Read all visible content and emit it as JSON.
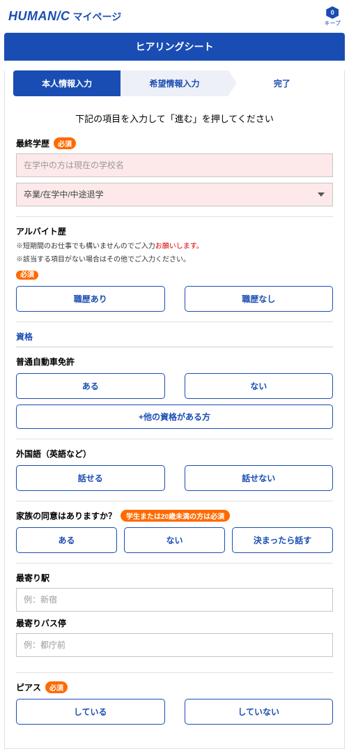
{
  "header": {
    "logo_main": "HUMAN/C",
    "logo_sub": "マイページ",
    "keep": {
      "count": "0",
      "label": "キープ"
    }
  },
  "page_title": "ヒアリングシート",
  "steps": {
    "s1": "本人情報入力",
    "s2": "希望情報入力",
    "s3": "完了"
  },
  "instruction": "下記の項目を入力して「進む」を押してください",
  "required_badge": "必須",
  "education": {
    "label": "最終学歴",
    "placeholder": "在学中の方は現在の学校名",
    "status_selected": "卒業/在学中/中途退学"
  },
  "parttime": {
    "label": "アルバイト歴",
    "note1_a": "※短期間のお仕事でも構いませんのでご入力",
    "note1_b": "お願いします。",
    "note2": "※該当する項目がない場合はその他でご入力ください。",
    "btn_yes": "職歴あり",
    "btn_no": "職歴なし"
  },
  "qualification": {
    "title": "資格",
    "license_label": "普通自動車免許",
    "btn_yes": "ある",
    "btn_no": "ない",
    "btn_other": "+他の資格がある方"
  },
  "language": {
    "label": "外国語（英語など）",
    "btn_yes": "話せる",
    "btn_no": "話せない"
  },
  "family": {
    "label": "家族の同意はありますか？",
    "badge": "学生または20歳未満の方は必須",
    "btn_yes": "ある",
    "btn_no": "ない",
    "btn_later": "決まったら話す"
  },
  "station": {
    "label": "最寄り駅",
    "placeholder": "例：新宿"
  },
  "bus": {
    "label": "最寄りバス停",
    "placeholder": "例：都庁前"
  },
  "pierce": {
    "label": "ピアス",
    "btn_yes": "している",
    "btn_no": "していない"
  }
}
